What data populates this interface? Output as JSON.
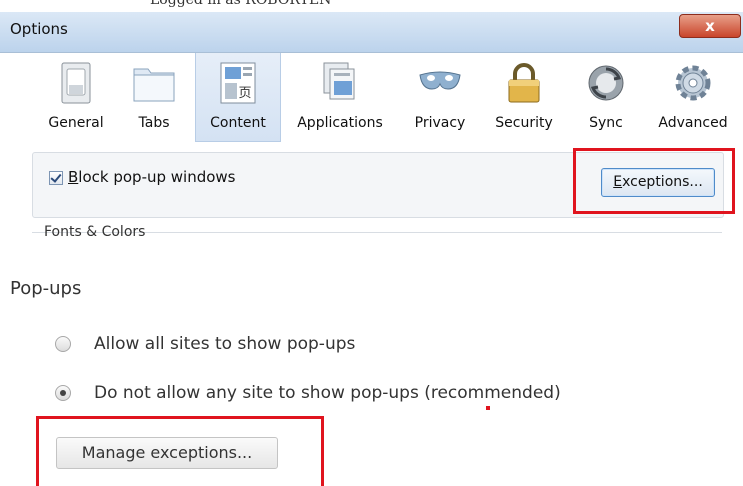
{
  "firefox": {
    "behind_text": "Logged in as ROBORTEN",
    "window_title": "Options",
    "close_label": "x",
    "tabs": [
      {
        "label": "General",
        "icon": "general-switch-icon"
      },
      {
        "label": "Tabs",
        "icon": "tabs-folder-icon"
      },
      {
        "label": "Content",
        "icon": "content-page-icon",
        "active": true
      },
      {
        "label": "Applications",
        "icon": "applications-icon"
      },
      {
        "label": "Privacy",
        "icon": "privacy-mask-icon"
      },
      {
        "label": "Security",
        "icon": "security-lock-icon"
      },
      {
        "label": "Sync",
        "icon": "sync-icon"
      },
      {
        "label": "Advanced",
        "icon": "advanced-gear-icon"
      }
    ],
    "block_popups": {
      "label_underlined": "B",
      "label_rest": "lock pop-up windows",
      "checked": true
    },
    "exceptions_button": {
      "underlined": "E",
      "rest": "xceptions..."
    },
    "fonts_colors_label": "Fonts & Colors",
    "highlight_color": "#e0141e"
  },
  "chrome": {
    "section_title": "Pop-ups",
    "options": [
      {
        "label": "Allow all sites to show pop-ups",
        "checked": false
      },
      {
        "label": "Do not allow any site to show pop-ups (recommended)",
        "checked": true
      }
    ],
    "manage_button": "Manage exceptions..."
  }
}
